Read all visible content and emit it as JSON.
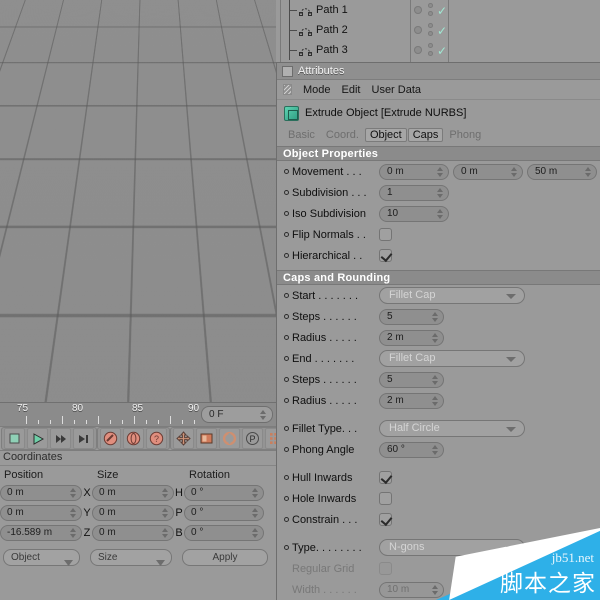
{
  "viewport": {
    "name": "perspective-viewport",
    "selected_object_style": "white-wireframe-tube"
  },
  "timeline": {
    "ticks": [
      "75",
      "80",
      "85",
      "90"
    ],
    "frame_field": {
      "value": "0 F",
      "name": "current-frame"
    }
  },
  "transport": {
    "buttons": [
      "play-backward",
      "play-forward",
      "step-forward",
      "go-to-end"
    ],
    "record": [
      "record-keyframe",
      "autokey",
      "keyframe-selection-help"
    ],
    "tools": [
      "move-tool",
      "scale-tool",
      "rotate-tool",
      "parametric-tool",
      "point-mode",
      "snap-tool",
      "render-view"
    ]
  },
  "coordinates": {
    "title": "Coordinates",
    "headers": [
      "Position",
      "Size",
      "Rotation"
    ],
    "axis_labels": [
      "X",
      "Y",
      "Z"
    ],
    "rot_labels": [
      "H",
      "P",
      "B"
    ],
    "position": [
      "0 m",
      "0 m",
      "-16.589 m"
    ],
    "size": [
      "0 m",
      "0 m",
      "0 m"
    ],
    "rotation": [
      "0 °",
      "0 °",
      "0 °"
    ],
    "mode_dropdown": "Object",
    "size_dropdown": "Size",
    "apply_button": "Apply"
  },
  "object_manager": {
    "items": [
      {
        "label": "Path 1",
        "icon": "spline-icon",
        "visible": true
      },
      {
        "label": "Path 2",
        "icon": "spline-icon",
        "visible": true
      },
      {
        "label": "Path 3",
        "icon": "spline-icon",
        "visible": true
      }
    ],
    "check_glyph": "✓"
  },
  "attributes": {
    "window_title": "Attributes",
    "menu": [
      "Mode",
      "Edit",
      "User Data"
    ],
    "object_name": "Extrude Object [Extrude NURBS]",
    "tabs": [
      {
        "label": "Basic",
        "active": false
      },
      {
        "label": "Coord.",
        "active": false
      },
      {
        "label": "Object",
        "active": true
      },
      {
        "label": "Caps",
        "active": true
      },
      {
        "label": "Phong",
        "active": false
      }
    ],
    "object_properties": {
      "header": "Object Properties",
      "movement_label": "Movement . . .",
      "movement": [
        "0 m",
        "0 m",
        "50 m"
      ],
      "subdivision_label": "Subdivision . . .",
      "subdivision": "1",
      "iso_subdivision_label": "Iso Subdivision",
      "iso_subdivision": "10",
      "flip_normals_label": "Flip Normals . .",
      "flip_normals": false,
      "hierarchical_label": "Hierarchical . .",
      "hierarchical": true
    },
    "caps_and_rounding": {
      "header": "Caps and Rounding",
      "start_label": "Start . . . . . . .",
      "start": "Fillet Cap",
      "start_steps_label": "Steps . . . . . . ",
      "start_steps": "5",
      "start_radius_label": "Radius . . . . . ",
      "start_radius": "2 m",
      "end_label": "End . . . . . . . ",
      "end": "Fillet Cap",
      "end_steps_label": "Steps . . . . . . ",
      "end_steps": "5",
      "end_radius_label": "Radius . . . . . ",
      "end_radius": "2 m",
      "fillet_type_label": "Fillet Type. . . ",
      "fillet_type": "Half Circle",
      "phong_angle_label": "Phong Angle",
      "phong_angle": "60 °",
      "hull_inwards_label": "Hull Inwards",
      "hull_inwards": true,
      "hole_inwards_label": "Hole Inwards",
      "hole_inwards": false,
      "constrain_label": "Constrain . . .",
      "constrain": true,
      "type_label": "Type. . . . . . . .",
      "type": "N-gons",
      "regular_grid_label": "Regular Grid",
      "regular_grid": false,
      "width_label": "Width . . . . . . ",
      "width": "10 m"
    }
  },
  "watermark": {
    "english": "jb51.net",
    "chinese": "脚本之家"
  },
  "colors": {
    "panel_bg": "#9a9a9a",
    "section_header_bg": "#8b8b8b",
    "field_bg": "#8f8f8f",
    "accent_check": "#9fe8d2",
    "watermark_blue": "#2eb0e8",
    "object_icon": "#3fbf9c"
  }
}
